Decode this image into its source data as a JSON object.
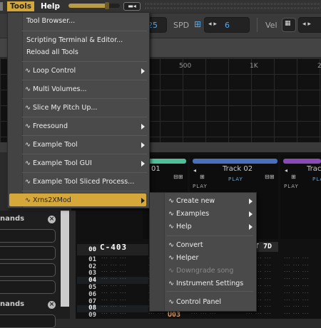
{
  "menubar": {
    "tools": "Tools",
    "help": "Help",
    "slider_level": 0.75,
    "mini_button_icon": "panel-toggle-icon"
  },
  "toolbar": {
    "lpb_value": "25",
    "spd_label": "SPD",
    "spd_value": "6",
    "vel_label": "Vel"
  },
  "spectrum": {
    "labels": [
      "500",
      "1K",
      "2"
    ]
  },
  "tracks": [
    {
      "name": "01",
      "color": "#4fbf9a",
      "play": "PLAY"
    },
    {
      "name": "Track 02",
      "color": "#4a6fbd",
      "play": "PLAY",
      "sub_play": "PLAY"
    },
    {
      "name": "Trac",
      "color": "#8a4ab8",
      "play": "PLA",
      "sub_play": "PLAY"
    }
  ],
  "left_panel": {
    "titles": [
      "nands",
      "nands"
    ]
  },
  "pattern": {
    "rows": [
      "00",
      "01",
      "02",
      "03",
      "04",
      "05",
      "06",
      "07",
      "08",
      "09"
    ],
    "first_note": "C-403",
    "fx_text": "T 7D",
    "bottom_val": "U03"
  },
  "tools_menu": {
    "items": [
      "Tool Browser...",
      "Scripting Terminal & Editor...",
      "Reload all Tools",
      "∿ Loop Control",
      "∿ Multi Volumes...",
      "∿ Slice My Pitch Up...",
      "∿ Freesound",
      "∿ Example Tool",
      "∿ Example Tool GUI",
      "∿ Example Tool Sliced Process...",
      "∿ Xrns2XMod"
    ],
    "highlight_color": "#d6a83a"
  },
  "submenu": {
    "items": [
      "∿ Create new",
      "∿ Examples",
      "∿ Help",
      "∿ Convert",
      "∿ Helper",
      "∿ Downgrade song",
      "∿ Instrument Settings",
      "∿ Control Panel"
    ]
  }
}
